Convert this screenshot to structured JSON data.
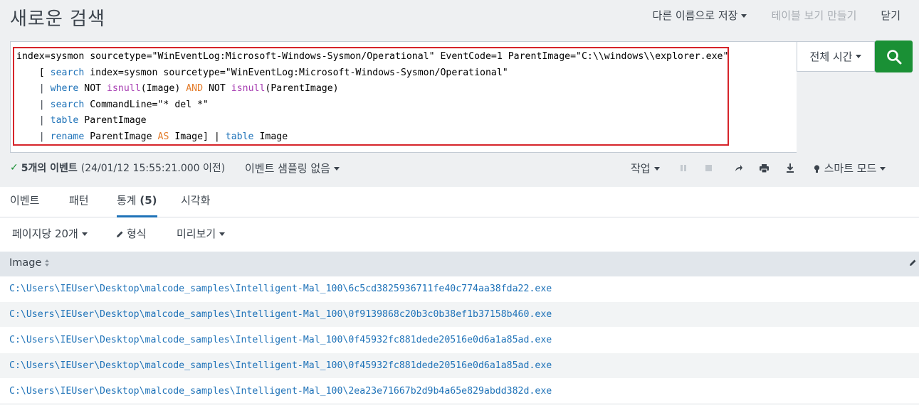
{
  "header": {
    "title": "새로운 검색",
    "save_as": "다른 이름으로 저장",
    "create_table_view": "테이블 보기 만들기",
    "close": "닫기"
  },
  "search": {
    "query_lines": [
      [
        {
          "t": "index=sysmon sourcetype=\"WinEventLog:Microsoft-Windows-Sysmon/Operational\" EventCode=1 ParentImage=\"C:\\\\windows\\\\explorer.exe\"",
          "c": "plain"
        }
      ],
      [
        {
          "t": "    [ ",
          "c": "plain"
        },
        {
          "t": "search",
          "c": "cmd"
        },
        {
          "t": " index=sysmon sourcetype=\"WinEventLog:Microsoft-Windows-Sysmon/Operational\"",
          "c": "plain"
        }
      ],
      [
        {
          "t": "    | ",
          "c": "pipe"
        },
        {
          "t": "where",
          "c": "cmd"
        },
        {
          "t": " NOT ",
          "c": "plain"
        },
        {
          "t": "isnull",
          "c": "fn"
        },
        {
          "t": "(Image) ",
          "c": "plain"
        },
        {
          "t": "AND",
          "c": "kw"
        },
        {
          "t": " NOT ",
          "c": "plain"
        },
        {
          "t": "isnull",
          "c": "fn"
        },
        {
          "t": "(ParentImage)",
          "c": "plain"
        }
      ],
      [
        {
          "t": "    | ",
          "c": "pipe"
        },
        {
          "t": "search",
          "c": "cmd"
        },
        {
          "t": " CommandLine=\"* del *\"",
          "c": "plain"
        }
      ],
      [
        {
          "t": "    | ",
          "c": "pipe"
        },
        {
          "t": "table",
          "c": "cmd"
        },
        {
          "t": " ParentImage",
          "c": "plain"
        }
      ],
      [
        {
          "t": "    | ",
          "c": "pipe"
        },
        {
          "t": "rename",
          "c": "cmd"
        },
        {
          "t": " ParentImage ",
          "c": "plain"
        },
        {
          "t": "AS",
          "c": "kw"
        },
        {
          "t": " Image] | ",
          "c": "plain"
        },
        {
          "t": "table",
          "c": "cmd"
        },
        {
          "t": " Image",
          "c": "plain"
        }
      ]
    ],
    "time_range": "전체 시간"
  },
  "status": {
    "event_count": "5개의 이벤트",
    "timestamp": "(24/01/12 15:55:21.000 이전)",
    "sampling": "이벤트 샘플링 없음"
  },
  "toolbar": {
    "job": "작업",
    "smart_mode": "스마트 모드"
  },
  "tabs": {
    "events": "이벤트",
    "patterns": "패턴",
    "statistics": "통계",
    "statistics_count": "(5)",
    "visualization": "시각화"
  },
  "table_controls": {
    "per_page": "페이지당 20개",
    "format": "형식",
    "preview": "미리보기"
  },
  "table": {
    "column": "Image",
    "rows": [
      "C:\\Users\\IEUser\\Desktop\\malcode_samples\\Intelligent-Mal_100\\6c5cd3825936711fe40c774aa38fda22.exe",
      "C:\\Users\\IEUser\\Desktop\\malcode_samples\\Intelligent-Mal_100\\0f9139868c20b3c0b38ef1b37158b460.exe",
      "C:\\Users\\IEUser\\Desktop\\malcode_samples\\Intelligent-Mal_100\\0f45932fc881dede20516e0d6a1a85ad.exe",
      "C:\\Users\\IEUser\\Desktop\\malcode_samples\\Intelligent-Mal_100\\0f45932fc881dede20516e0d6a1a85ad.exe",
      "C:\\Users\\IEUser\\Desktop\\malcode_samples\\Intelligent-Mal_100\\2ea23e71667b2d9b4a65e829abdd382d.exe"
    ]
  },
  "colors": {
    "accent": "#1e72b8",
    "search_button": "#1a9035",
    "highlight_border": "#d6242a"
  },
  "icons": [
    "search-icon",
    "check-icon",
    "pause-icon",
    "stop-icon",
    "share-icon",
    "print-icon",
    "export-icon",
    "bulb-icon",
    "pencil-icon",
    "sort-icon",
    "column-edit-icon"
  ]
}
